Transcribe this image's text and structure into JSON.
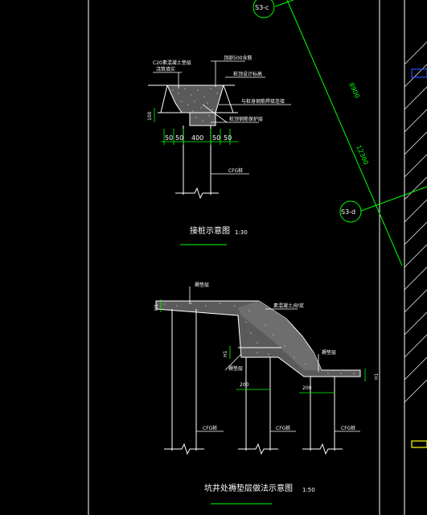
{
  "colors": {
    "background": "#000000",
    "linework": "#ffffff",
    "green": "#00ff00",
    "blue": "#2a4dff",
    "yellow": "#ffff00",
    "hatch": "#bdbdbd"
  },
  "grid_bubbles": {
    "top": "S3-c",
    "right": "S3-d"
  },
  "axis_dims": {
    "d1": "8900",
    "d2": "12300"
  },
  "detail1": {
    "title": "接桩示意图",
    "scale": "1:30",
    "notes": {
      "cushion": "C20素混凝土垫层",
      "cushion2": "浇筑填实",
      "capping": "顶部500含筋",
      "base_elev": "桩顶设计标高",
      "steel": "与桩身钢筋焊接连接",
      "rebar": "桩顶钢筋保护层"
    },
    "dims": {
      "d100": "100",
      "d50a": "50",
      "d50b": "50",
      "d400": "400",
      "d50c": "50",
      "d50d": "50"
    },
    "pile": "CFG桩"
  },
  "detail2": {
    "title": "坑井处褥垫层做法示意图",
    "scale": "1:50",
    "notes": {
      "cushion_left": "褥垫层",
      "slope": "素混凝土/砂浆",
      "cushion_right": "褥垫层",
      "cushion_pit": "褥垫层"
    },
    "dims": {
      "h_left": "H1",
      "h_pit": "H1",
      "h_right": "H1",
      "w200a": "200",
      "w200b": "200"
    },
    "piles": [
      "CFG桩",
      "CFG桩",
      "CFG桩"
    ]
  }
}
